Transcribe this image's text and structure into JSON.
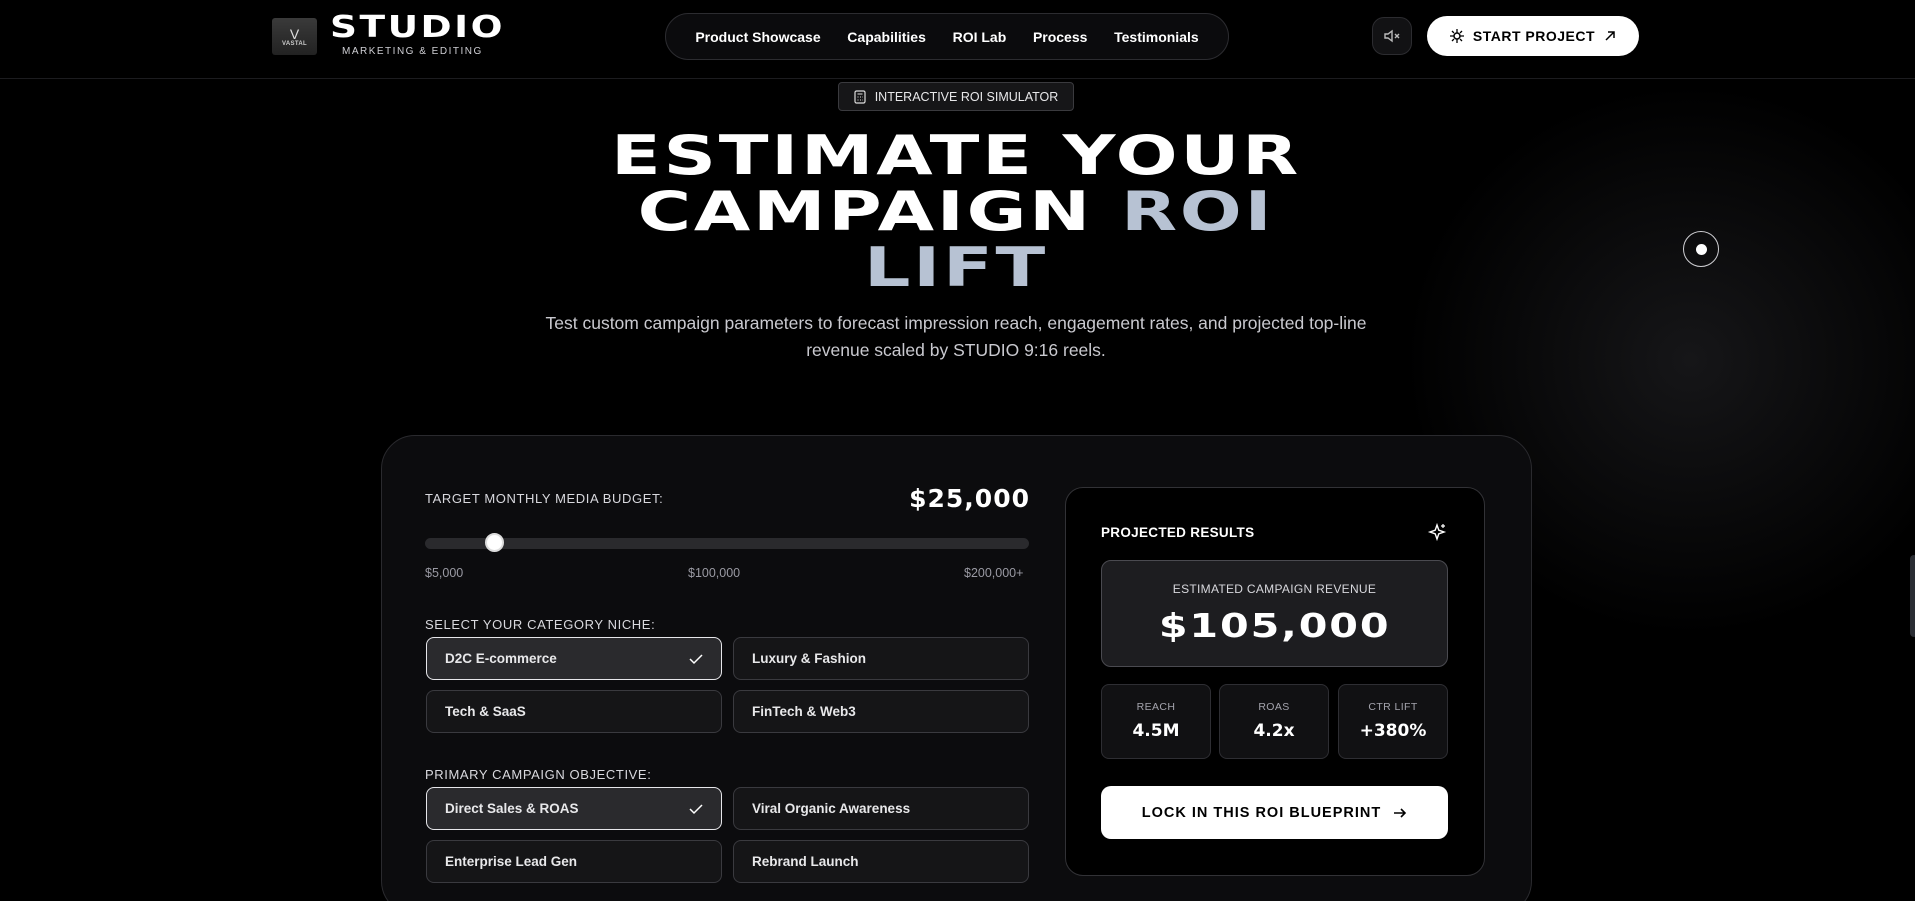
{
  "nav": {
    "logo_mark": "V",
    "logo_sub": "VASTAL",
    "brand": "STUDIO",
    "brand_sub": "MARKETING & EDITING",
    "links": [
      "Product Showcase",
      "Capabilities",
      "ROI Lab",
      "Process",
      "Testimonials"
    ],
    "cta": "START PROJECT"
  },
  "hero": {
    "badge": "INTERACTIVE ROI SIMULATOR",
    "title_line1": "ESTIMATE YOUR",
    "title_line2a": "CAMPAIGN",
    "title_line2b": "ROI",
    "title_line3": "LIFT",
    "subtitle": "Test custom campaign parameters to forecast impression reach, engagement rates, and projected top-line revenue scaled by STUDIO 9:16 reels."
  },
  "simulator": {
    "budget_label": "TARGET MONTHLY MEDIA BUDGET:",
    "budget_value": "$25,000",
    "slider_fraction": 0.1145,
    "ticks": [
      "$5,000",
      "$100,000",
      "$200,000+"
    ],
    "niche_label": "SELECT YOUR CATEGORY NICHE:",
    "niches": [
      "D2C E-commerce",
      "Luxury & Fashion",
      "Tech & SaaS",
      "FinTech & Web3"
    ],
    "objective_label": "PRIMARY CAMPAIGN OBJECTIVE:",
    "objectives": [
      "Direct Sales & ROAS",
      "Viral Organic Awareness",
      "Enterprise Lead Gen",
      "Rebrand Launch"
    ]
  },
  "results": {
    "title": "PROJECTED RESULTS",
    "revenue_label": "ESTIMATED CAMPAIGN REVENUE",
    "revenue_value": "$105,000",
    "stats": [
      {
        "label": "REACH",
        "value": "4.5M"
      },
      {
        "label": "ROAS",
        "value": "4.2x"
      },
      {
        "label": "CTR LIFT",
        "value": "+380%"
      }
    ],
    "cta": "LOCK IN THIS ROI BLUEPRINT"
  },
  "icons": {
    "mute": "speaker-muted-icon",
    "cta": "crosshair-icon",
    "badge": "calculator-icon",
    "sparkle": "sparkle-icon"
  }
}
